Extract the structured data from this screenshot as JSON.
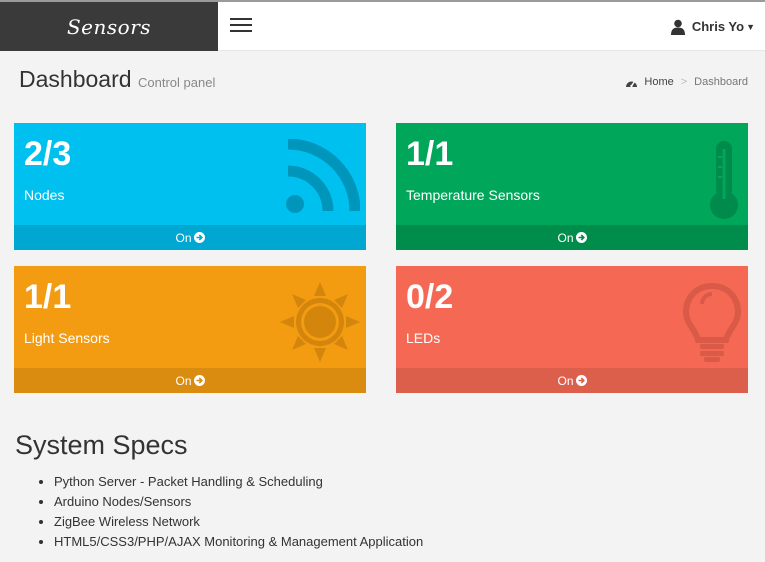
{
  "header": {
    "logo": "Sensors",
    "user_name": "Chris Yo"
  },
  "page": {
    "title": "Dashboard",
    "subtitle": "Control panel"
  },
  "breadcrumb": {
    "home": "Home",
    "current": "Dashboard"
  },
  "boxes": [
    {
      "value": "2/3",
      "label": "Nodes",
      "footer": "On",
      "icon": "rss-icon",
      "color": "#00c0ef"
    },
    {
      "value": "1/1",
      "label": "Temperature Sensors",
      "footer": "On",
      "icon": "thermometer-icon",
      "color": "#00a65a"
    },
    {
      "value": "1/1",
      "label": "Light Sensors",
      "footer": "On",
      "icon": "sun-icon",
      "color": "#f39c12"
    },
    {
      "value": "0/2",
      "label": "LEDs",
      "footer": "On",
      "icon": "lightbulb-icon",
      "color": "#f56954"
    }
  ],
  "specs": {
    "title": "System Specs",
    "items": [
      "Python Server - Packet Handling & Scheduling",
      "Arduino Nodes/Sensors",
      "ZigBee Wireless Network",
      "HTML5/CSS3/PHP/AJAX Monitoring & Management Application"
    ]
  }
}
